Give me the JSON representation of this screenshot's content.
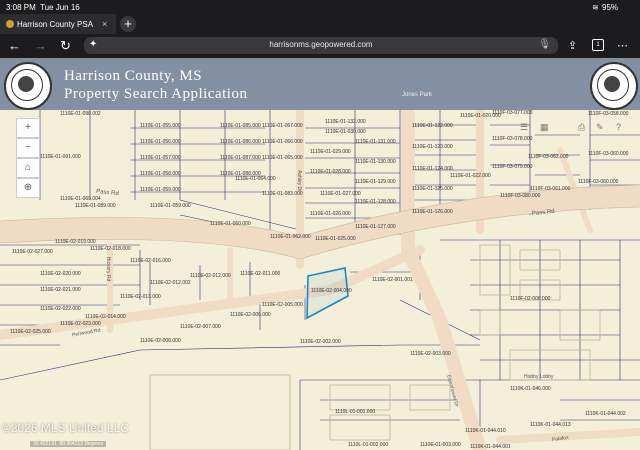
{
  "status_bar": {
    "time": "3:08 PM",
    "date": "Tue Jun 16",
    "battery": "95%"
  },
  "browser": {
    "tab_title": "Harrison County PSA",
    "url": "harrisonms.geopowered.com",
    "tab_count": "1"
  },
  "app": {
    "title_line1": "Harrison County, MS",
    "title_line2": "Property Search Application"
  },
  "map": {
    "roads": {
      "pass_rd": "Pass Rd",
      "pass_rd_2": "Pass Rd",
      "pass_rd_upper": "Pass Rd",
      "hickory": "Hickory Rd",
      "periwood": "Periwood Rd",
      "eisenhower": "Eisenhower Dr",
      "ashley": "Ashley Dr",
      "selected_parcel": "1110E-02-004.000",
      "park": "Jones Park",
      "lobby": "Hobby Lobby",
      "palafox": "Palafox"
    },
    "parcels": [
      "1110E-01-098.002",
      "1110E-01-055.000",
      "1110E-01-056.000",
      "1110E-01-057.000",
      "1110E-01-058.000",
      "1110E-01-059.000",
      "1110E-01-085.000",
      "1110E-01-086.000",
      "1110E-01-087.000",
      "1110E-01-088.000",
      "1110E-01-067.000",
      "1110E-01-066.000",
      "1110E-01-065.000",
      "1110E-01-064.000",
      "1110E-01-083.000",
      "1110E-01-060.000",
      "1110E-01-059.000",
      "1110E-01-062.000",
      "1110E-01-091.000",
      "1110E-01-089.000",
      "1110E-01-069.004",
      "1110E-01-132.000",
      "1110E-01-130.000",
      "1110E-01-029.000",
      "1110E-01-028.000",
      "1110E-01-027.000",
      "1110E-01-026.000",
      "1110E-01-025.000",
      "1110E-01-131.000",
      "1110E-01-130.000",
      "1110E-01-129.000",
      "1110E-01-128.000",
      "1110E-01-127.000",
      "1110E-01-122.000",
      "1110E-01-123.000",
      "1110E-01-124.000",
      "1110E-01-125.000",
      "1110E-01-126.000",
      "1110E-01-020.000",
      "1110E-01-022.000",
      "1110F-03-077.000",
      "1110F-03-078.000",
      "1110F-03-079.000",
      "1110F-03-080.000",
      "1110F-03-061.000",
      "1110F-03-062.000",
      "1110F-03-058.000",
      "1110F-03-060.000",
      "1110E-02-019.000",
      "1110E-02-018.000",
      "1110E-02-016.000",
      "1110E-02-027.000",
      "1110E-02-020.000",
      "1110E-02-021.000",
      "1110E-02-022.000",
      "1110E-02-023.000",
      "1110E-02-025.000",
      "1110E-02-013.000",
      "1110E-02-012.000",
      "1110E-02-012.002",
      "1110E-02-011.000",
      "1110E-02-014.000",
      "1110E-02-005.000",
      "1110E-02-006.000",
      "1110E-02-007.000",
      "1110E-02-008.000",
      "1110E-02-002.000",
      "1110E-02-001.001",
      "1110E-02-003.000",
      "1110E-02-006.000",
      "1110K-01-046.000",
      "1110K-01-044.002",
      "1110K-01-044.010",
      "1110K-01-044.013",
      "1110K-01-044.001",
      "1110L-01-001.000",
      "1110L-01-002.000",
      "1110E-01-003.000",
      "1110L-01-002.000"
    ]
  },
  "footer": {
    "watermark": "©2026 MLS United LLC",
    "coords": "30.402131, 88.964213 Degrees"
  },
  "colors": {
    "parcel_fill": "#f4efd9",
    "road": "#f0dcc4",
    "selected": "#1f86c9",
    "header": "#7888a0"
  }
}
